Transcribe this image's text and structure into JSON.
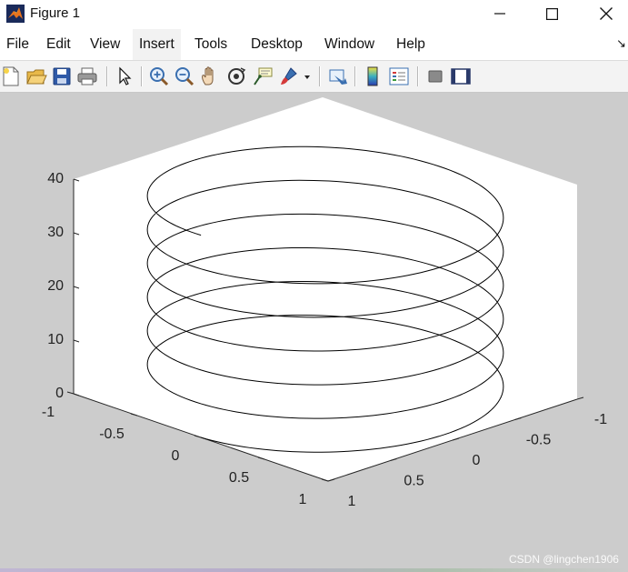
{
  "window": {
    "title": "Figure 1",
    "controls": {
      "minimize": "—",
      "maximize": "☐",
      "close": "✕"
    }
  },
  "menu": {
    "items": [
      "File",
      "Edit",
      "View",
      "Insert",
      "Tools",
      "Desktop",
      "Window",
      "Help"
    ],
    "active": "Insert",
    "overflow_glyph": "↘"
  },
  "toolbar": {
    "buttons": [
      "new-figure-icon",
      "open-file-icon",
      "save-icon",
      "print-icon",
      "select-arrow-icon",
      "zoom-in-icon",
      "zoom-out-icon",
      "pan-hand-icon",
      "rotate-3d-icon",
      "data-cursor-icon",
      "brush-icon",
      "brush-dropdown-icon",
      "link-plot-icon",
      "insert-colorbar-icon",
      "insert-legend-icon",
      "hide-plot-tools-icon",
      "show-plot-tools-icon"
    ]
  },
  "chart_data": {
    "type": "line",
    "projection": "3d",
    "curve": "helix",
    "x_expression": "sin(t)",
    "y_expression": "cos(t)",
    "z_expression": "t",
    "t_range": [
      0,
      37.7
    ],
    "xlim": [
      -1,
      1
    ],
    "ylim": [
      -1,
      1
    ],
    "zlim": [
      0,
      40
    ],
    "x_ticks": [
      "-1",
      "-0.5",
      "0",
      "0.5",
      "1"
    ],
    "y_ticks": [
      "-1",
      "-0.5",
      "0",
      "0.5",
      "1"
    ],
    "z_ticks": [
      "0",
      "10",
      "20",
      "30",
      "40"
    ],
    "line_color": "#000000",
    "axes_background": "#ffffff",
    "figure_background": "#cccccc",
    "grid": false
  },
  "watermark": "CSDN @lingchen1906"
}
